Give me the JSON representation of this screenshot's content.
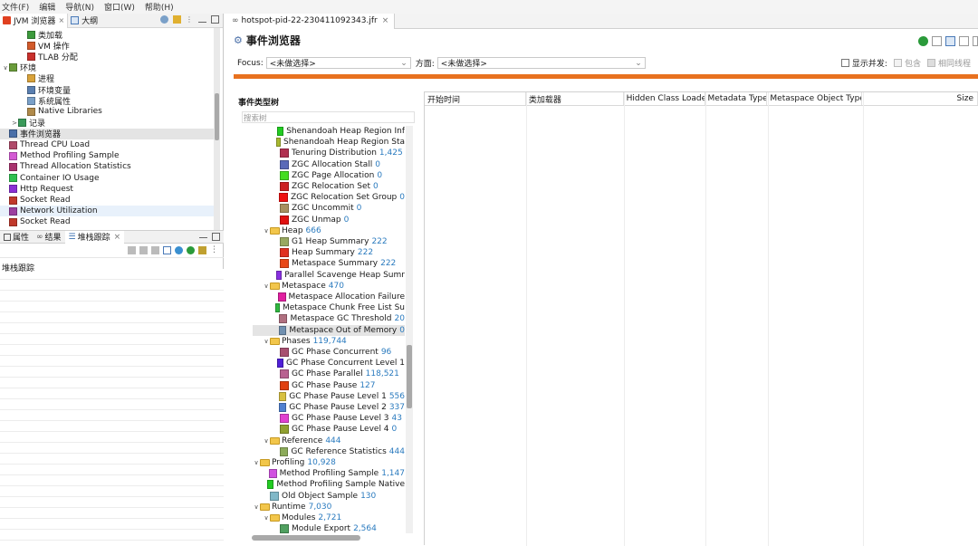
{
  "menu": [
    "文件(F)",
    "编辑",
    "导航(N)",
    "窗口(W)",
    "帮助(H)"
  ],
  "left_tabs": {
    "jvm": "JVM 浏览器",
    "outline": "大纲"
  },
  "left_tree": [
    {
      "indent": 2,
      "arrow": "",
      "icon": "#3c9a3c",
      "label": "类加载"
    },
    {
      "indent": 2,
      "arrow": "",
      "icon": "#d25a2a",
      "label": "VM 操作"
    },
    {
      "indent": 2,
      "arrow": "",
      "icon": "#c9302c",
      "label": "TLAB 分配"
    },
    {
      "indent": 0,
      "arrow": "∨",
      "icon": "#6a9c3a",
      "label": "环境"
    },
    {
      "indent": 2,
      "arrow": "",
      "icon": "#d9a23a",
      "label": "进程"
    },
    {
      "indent": 2,
      "arrow": "",
      "icon": "#5a7fb0",
      "label": "环境变量"
    },
    {
      "indent": 2,
      "arrow": "",
      "icon": "#7aa0c8",
      "label": "系统属性"
    },
    {
      "indent": 2,
      "arrow": "",
      "icon": "#b08a4a",
      "label": "Native Libraries"
    },
    {
      "indent": 1,
      "arrow": ">",
      "icon": "#3a9a5a",
      "label": "记录"
    },
    {
      "indent": 0,
      "arrow": "",
      "icon": "#4a6fa8",
      "label": "事件浏览器",
      "selected": true
    },
    {
      "indent": 0,
      "arrow": "",
      "icon": "#b04a6a",
      "label": "Thread CPU Load"
    },
    {
      "indent": 0,
      "arrow": "",
      "icon": "#d45ad4",
      "label": "Method Profiling Sample"
    },
    {
      "indent": 0,
      "arrow": "",
      "icon": "#a8326e",
      "label": "Thread Allocation Statistics"
    },
    {
      "indent": 0,
      "arrow": "",
      "icon": "#2fbf4f",
      "label": "Container IO Usage"
    },
    {
      "indent": 0,
      "arrow": "",
      "icon": "#8a2fd4",
      "label": "Http Request"
    },
    {
      "indent": 0,
      "arrow": "",
      "icon": "#c0392b",
      "label": "Socket Read"
    },
    {
      "indent": 0,
      "arrow": "",
      "icon": "#9b3fa0",
      "label": "Network Utilization",
      "highlight": true
    },
    {
      "indent": 0,
      "arrow": "",
      "icon": "#c0392b",
      "label": "Socket Read"
    }
  ],
  "bottom_tabs": {
    "props": "属性",
    "results": "结果",
    "stack": "堆栈跟踪"
  },
  "stack_label": "堆栈跟踪",
  "file_tab": "hotspot-pid-22-230411092343.jfr",
  "page_title": "事件浏览器",
  "filter": {
    "focus_label": "Focus:",
    "focus_value": "<未做选择>",
    "aspect_label": "方面:",
    "aspect_value": "<未做选择>",
    "concurrent_label": "显示并发:",
    "contains_label": "包含",
    "same_thread_label": "相同线程"
  },
  "type_tree_title": "事件类型树",
  "search_placeholder": "搜索树",
  "event_tree": [
    {
      "indent": 2,
      "type": "item",
      "color": "#22cc22",
      "label": "Shenandoah Heap Region Inf",
      "count": ""
    },
    {
      "indent": 2,
      "type": "item",
      "color": "#a8b830",
      "label": "Shenandoah Heap Region Sta",
      "count": ""
    },
    {
      "indent": 2,
      "type": "item",
      "color": "#b03050",
      "label": "Tenuring Distribution",
      "count": "1,425"
    },
    {
      "indent": 2,
      "type": "item",
      "color": "#5a6ab8",
      "label": "ZGC Allocation Stall",
      "count": "0"
    },
    {
      "indent": 2,
      "type": "item",
      "color": "#44dd22",
      "label": "ZGC Page Allocation",
      "count": "0"
    },
    {
      "indent": 2,
      "type": "item",
      "color": "#cc2222",
      "label": "ZGC Relocation Set",
      "count": "0"
    },
    {
      "indent": 2,
      "type": "item",
      "color": "#ee1111",
      "label": "ZGC Relocation Set Group",
      "count": "0"
    },
    {
      "indent": 2,
      "type": "item",
      "color": "#a89060",
      "label": "ZGC Uncommit",
      "count": "0"
    },
    {
      "indent": 2,
      "type": "item",
      "color": "#e01010",
      "label": "ZGC Unmap",
      "count": "0"
    },
    {
      "indent": 1,
      "type": "folder",
      "label": "Heap",
      "count": "666"
    },
    {
      "indent": 2,
      "type": "item",
      "color": "#98a860",
      "label": "G1 Heap Summary",
      "count": "222"
    },
    {
      "indent": 2,
      "type": "item",
      "color": "#e03020",
      "label": "Heap Summary",
      "count": "222"
    },
    {
      "indent": 2,
      "type": "item",
      "color": "#e84818",
      "label": "Metaspace Summary",
      "count": "222"
    },
    {
      "indent": 2,
      "type": "item",
      "color": "#8830e0",
      "label": "Parallel Scavenge Heap Sumr",
      "count": ""
    },
    {
      "indent": 1,
      "type": "folder",
      "label": "Metaspace",
      "count": "470"
    },
    {
      "indent": 2,
      "type": "item",
      "color": "#e020a0",
      "label": "Metaspace Allocation Failure",
      "count": ""
    },
    {
      "indent": 2,
      "type": "item",
      "color": "#30b840",
      "label": "Metaspace Chunk Free List Su",
      "count": ""
    },
    {
      "indent": 2,
      "type": "item",
      "color": "#b07080",
      "label": "Metaspace GC Threshold",
      "count": "20"
    },
    {
      "indent": 2,
      "type": "item",
      "color": "#7090b0",
      "label": "Metaspace Out of Memory",
      "count": "0",
      "selected": true
    },
    {
      "indent": 1,
      "type": "folder",
      "label": "Phases",
      "count": "119,744"
    },
    {
      "indent": 2,
      "type": "item",
      "color": "#a85070",
      "label": "GC Phase Concurrent",
      "count": "96"
    },
    {
      "indent": 2,
      "type": "item",
      "color": "#5020d8",
      "label": "GC Phase Concurrent Level 1",
      "count": ""
    },
    {
      "indent": 2,
      "type": "item",
      "color": "#b86090",
      "label": "GC Phase Parallel",
      "count": "118,521"
    },
    {
      "indent": 2,
      "type": "item",
      "color": "#e04010",
      "label": "GC Phase Pause",
      "count": "127"
    },
    {
      "indent": 2,
      "type": "item",
      "color": "#d8c040",
      "label": "GC Phase Pause Level 1",
      "count": "556"
    },
    {
      "indent": 2,
      "type": "item",
      "color": "#5080d0",
      "label": "GC Phase Pause Level 2",
      "count": "337"
    },
    {
      "indent": 2,
      "type": "item",
      "color": "#e040d0",
      "label": "GC Phase Pause Level 3",
      "count": "43"
    },
    {
      "indent": 2,
      "type": "item",
      "color": "#90a030",
      "label": "GC Phase Pause Level 4",
      "count": "0"
    },
    {
      "indent": 1,
      "type": "folder",
      "label": "Reference",
      "count": "444"
    },
    {
      "indent": 2,
      "type": "item",
      "color": "#8cab5a",
      "label": "GC Reference Statistics",
      "count": "444"
    },
    {
      "indent": 0,
      "type": "folder",
      "label": "Profiling",
      "count": "10,928"
    },
    {
      "indent": 1,
      "type": "item",
      "color": "#d050e0",
      "label": "Method Profiling Sample",
      "count": "1,147"
    },
    {
      "indent": 1,
      "type": "item",
      "color": "#22cc22",
      "label": "Method Profiling Sample Native",
      "count": ""
    },
    {
      "indent": 1,
      "type": "item",
      "color": "#80b8c8",
      "label": "Old Object Sample",
      "count": "130"
    },
    {
      "indent": 0,
      "type": "folder",
      "label": "Runtime",
      "count": "7,030"
    },
    {
      "indent": 1,
      "type": "folder",
      "label": "Modules",
      "count": "2,721"
    },
    {
      "indent": 2,
      "type": "item",
      "color": "#50a060",
      "label": "Module Export",
      "count": "2,564"
    }
  ],
  "table_columns": [
    "开始时间",
    "类加载器",
    "Hidden Class Loader",
    "Metadata Type",
    "Metaspace Object Type",
    "Size"
  ]
}
